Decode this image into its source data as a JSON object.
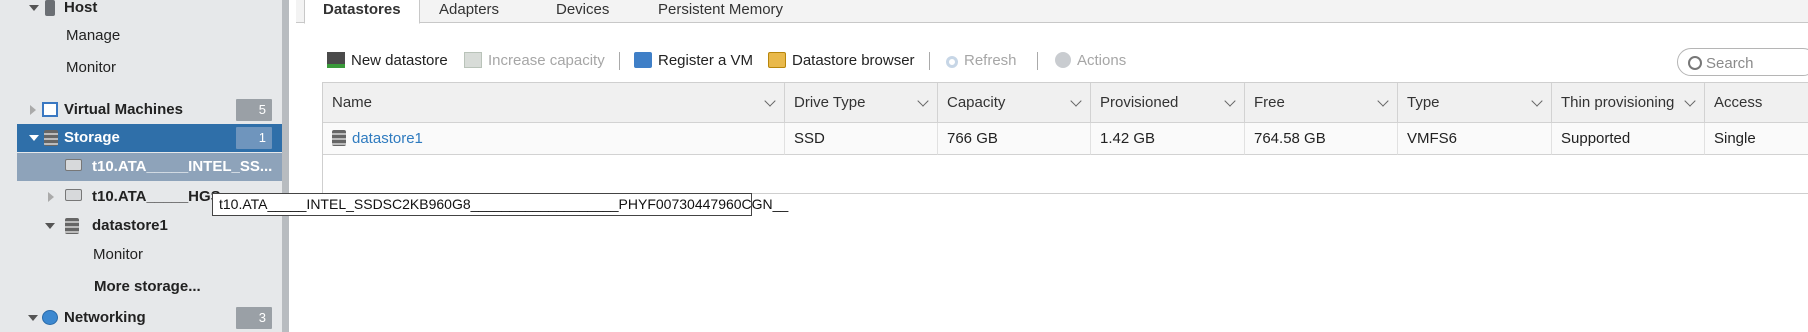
{
  "nav": {
    "host": {
      "label": "Host"
    },
    "manage": {
      "label": "Manage"
    },
    "monitor": {
      "label": "Monitor"
    },
    "virtual_machines": {
      "label": "Virtual Machines",
      "badge": "5"
    },
    "storage": {
      "label": "Storage",
      "badge": "1"
    },
    "device_intel": {
      "label": "t10.ATA_____INTEL_SS..."
    },
    "device_hgst": {
      "label": "t10.ATA_____HGS"
    },
    "datastore1": {
      "label": "datastore1"
    },
    "datastore_monitor": {
      "label": "Monitor"
    },
    "more_storage": {
      "label": "More storage..."
    },
    "networking": {
      "label": "Networking",
      "badge": "3"
    }
  },
  "tabs": [
    "Datastores",
    "Adapters",
    "Devices",
    "Persistent Memory"
  ],
  "toolbar": {
    "new_datastore": "New datastore",
    "increase_capacity": "Increase capacity",
    "register_vm": "Register a VM",
    "datastore_browser": "Datastore browser",
    "refresh": "Refresh",
    "actions": "Actions"
  },
  "search": {
    "placeholder": "Search"
  },
  "table": {
    "columns": [
      "Name",
      "Drive Type",
      "Capacity",
      "Provisioned",
      "Free",
      "Type",
      "Thin provisioning",
      "Access"
    ],
    "rows": [
      [
        "datastore1",
        "SSD",
        "766 GB",
        "1.42 GB",
        "764.58 GB",
        "VMFS6",
        "Supported",
        "Single"
      ]
    ]
  },
  "tooltip": {
    "text": "t10.ATA_____INTEL_SSDSC2KB960G8___________________PHYF00730447960CGN__"
  },
  "colors": {
    "selected": "#2f6fa9",
    "link": "#2f7bbf",
    "badge": "#9aa0a6"
  }
}
